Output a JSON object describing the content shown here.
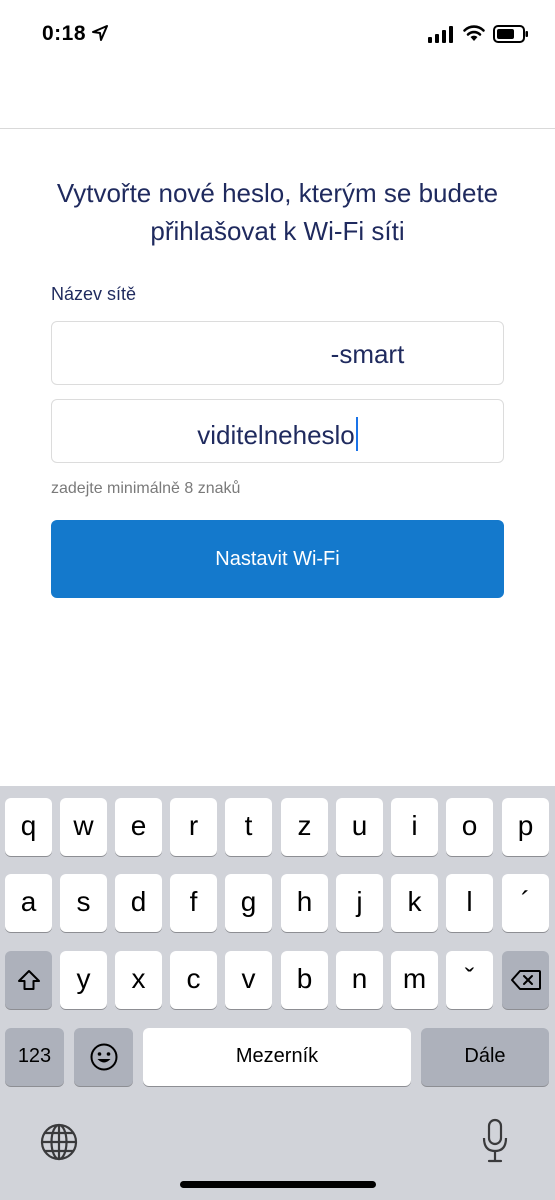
{
  "status_bar": {
    "time": "0:18",
    "icons": [
      "location-arrow-icon",
      "cellular-signal-icon",
      "wifi-icon",
      "battery-icon"
    ]
  },
  "form": {
    "title": "Vytvořte nové heslo, kterým se budete přihlašovat k Wi-Fi síti",
    "network_label": "Název sítě",
    "ssid_value": "-smart",
    "password_value": "viditelneheslo",
    "hint": "zadejte minimálně 8 znaků",
    "submit_label": "Nastavit Wi-Fi"
  },
  "keyboard": {
    "row1": [
      "q",
      "w",
      "e",
      "r",
      "t",
      "z",
      "u",
      "i",
      "o",
      "p"
    ],
    "row2": [
      "a",
      "s",
      "d",
      "f",
      "g",
      "h",
      "j",
      "k",
      "l",
      "´"
    ],
    "row3": [
      "y",
      "x",
      "c",
      "v",
      "b",
      "n",
      "m",
      "ˇ"
    ],
    "numbers_label": "123",
    "space_label": "Mezerník",
    "return_label": "Dále"
  },
  "colors": {
    "title_text": "#1f2a5e",
    "primary_button": "#1479cc",
    "keyboard_background": "#d1d3d9",
    "caret": "#1a73e8"
  }
}
